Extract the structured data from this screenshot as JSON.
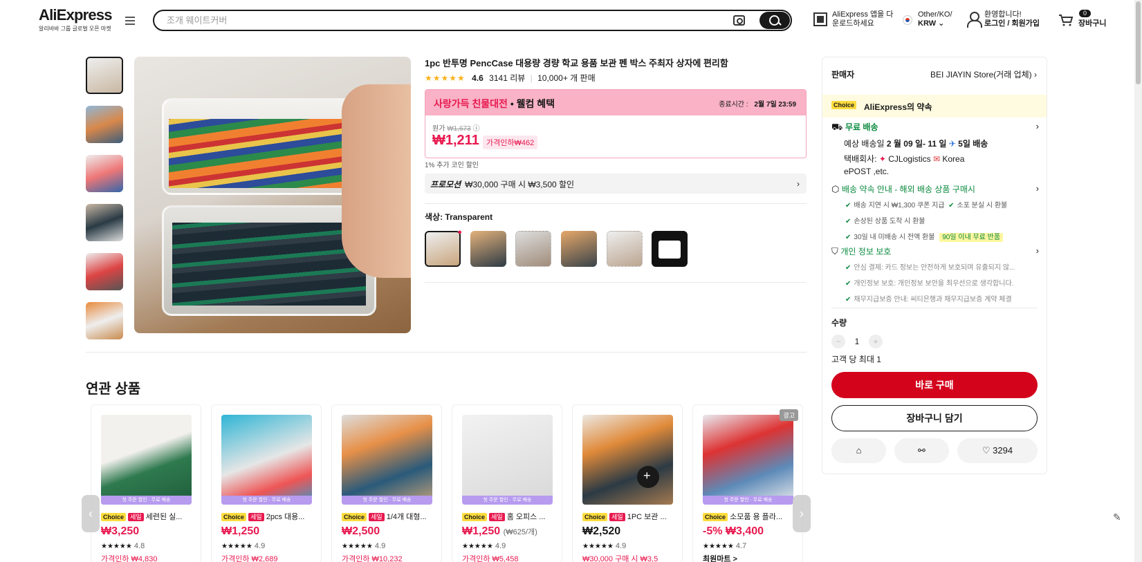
{
  "header": {
    "logo": "AliExpress",
    "logo_sub": "알리바바 그룹 글로벌 오픈 마켓",
    "search_placeholder": "조개 웨이트커버",
    "app_line1": "AliExpress 앱을 다",
    "app_line2": "운로드하세요",
    "region_line1": "Other/KO/",
    "region_line2": "KRW",
    "user_line1": "환영합니다!",
    "user_line2": "로그인 / 회원가입",
    "cart_count": "0",
    "cart_label": "장바구니"
  },
  "product": {
    "title": "1pc 반투명 PencCase 대용량 경량 학교 용품 보관 펜 박스 주최자 상자에 편리함",
    "stars": "★★★★★",
    "rating": "4.6",
    "reviews": "3141 리뷰",
    "sold": "10,000+ 개 판매",
    "promo_title_red": "사랑가득 친물대전",
    "promo_title_rest": "• 웰컴 혜택",
    "end_label": "종료시간 :",
    "end_time": "2월 7일 23:59",
    "orig_label": "원가",
    "orig_price": "₩1,673",
    "price": "₩1,211",
    "discount": "가격인하₩462",
    "coin": "1% 추가 코인 할인",
    "promotion_label": "프로모션",
    "promotion_text": "₩30,000 구매 시 ₩3,500 할인",
    "color_label": "색상:",
    "color_value": "Transparent"
  },
  "related": {
    "title": "연관 상품",
    "items": [
      {
        "choice": "Choice",
        "sale": "세일",
        "name": "세련된 실...",
        "price": "₩3,250",
        "unit": "",
        "stars": "★★★★★",
        "rating": "4.8",
        "extra": "가격인하 ₩4,830",
        "band": "첫 주문 할인 · 무료 배송"
      },
      {
        "choice": "Choice",
        "sale": "세일",
        "name": "2pcs 대용...",
        "price": "₩1,250",
        "unit": "",
        "stars": "★★★★★",
        "rating": "4.9",
        "extra": "가격인하 ₩2,689",
        "band": "첫 주문 할인 · 무료 배송"
      },
      {
        "choice": "Choice",
        "sale": "세일",
        "name": "1/4개 대형...",
        "price": "₩2,500",
        "unit": "",
        "stars": "★★★★★",
        "rating": "4.9",
        "extra": "가격인하 ₩10,232",
        "band": "첫 주문 할인 · 무료 배송"
      },
      {
        "choice": "Choice",
        "sale": "세일",
        "name": "홈 오피스 ...",
        "price": "₩1,250",
        "unit": "(₩625/개)",
        "stars": "★★★★★",
        "rating": "4.9",
        "extra": "가격인하 ₩5,458",
        "band": "첫 주문 할인 · 무료 배송"
      },
      {
        "choice": "Choice",
        "sale": "세일",
        "name": "1PC 보관 ...",
        "price": "₩2,520",
        "unit": "",
        "stars": "★★★★★",
        "rating": "4.9",
        "extra": "₩30,000 구매 시 ₩3,5",
        "band": ""
      },
      {
        "choice": "Choice",
        "sale": "",
        "name": "소모품 용 플라...",
        "price": "-5% ₩3,400",
        "unit": "",
        "stars": "★★★★★",
        "rating": "4.7",
        "extra": "최원마트 >",
        "band": "첫 주문 할인 · 무료 배송",
        "ad": "광고"
      }
    ]
  },
  "panel": {
    "seller_label": "판매자",
    "store": "BEI JIAYIN Store(거래 업체)",
    "choice": "Choice",
    "promise": "AliExpress의 약속",
    "free_ship": "무료 배송",
    "eta_prefix": "예상 배송일",
    "eta_dates": "2 월 09 일- 11 일",
    "eta_days": "5일 배송",
    "carrier_label": "택배회사:",
    "carrier1": "CJLogistics",
    "carrier2": "Korea",
    "carrier3": "ePOST ,etc.",
    "guide": "배송 약속 안내 - 해외 배송 상품 구매시",
    "g1": "배송 지연 시 ₩1,300 쿠폰 지급",
    "g2": "소포 분실 시 환불",
    "g3": "손상된 상품 도착 시 환불",
    "g4": "30일 내 미배송 시 전액 환불",
    "g4_badge": "90일 이내 무료 반품",
    "privacy": "개인 정보 보호",
    "p1": "안심 결제: 카드 정보는 안전하게 보호되며 유출되지 않...",
    "p2": "개인정보 보호: 개인정보 보안을 최우선으로 생각합니다.",
    "p3": "채무지급보증 안내: 씨티은행과 채무지급보증 계약 체결",
    "qty_label": "수량",
    "qty": "1",
    "limit": "고객 당 최대 1",
    "buy": "바로 구매",
    "add_cart": "장바구니 담기",
    "likes": "3294"
  },
  "colors": {
    "accent": "#e8194f",
    "buy": "#d3031c",
    "green": "#0a8a3e"
  }
}
